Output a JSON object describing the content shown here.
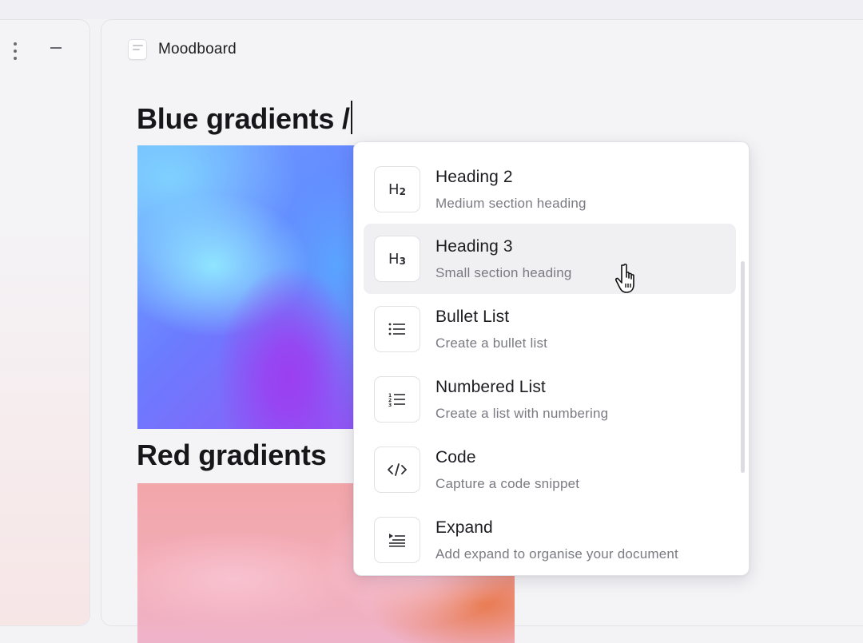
{
  "document": {
    "title": "Moodboard",
    "heading_blue": "Blue gradients /",
    "heading_red": "Red gradients"
  },
  "slash_menu": {
    "items": [
      {
        "title": "Heading 2",
        "description": "Medium section heading",
        "icon": "heading-2-icon",
        "glyph": "H",
        "sub": "2",
        "active": false
      },
      {
        "title": "Heading 3",
        "description": "Small section heading",
        "icon": "heading-3-icon",
        "glyph": "H",
        "sub": "3",
        "active": true
      },
      {
        "title": "Bullet List",
        "description": "Create a bullet list",
        "icon": "bullet-list-icon",
        "active": false
      },
      {
        "title": "Numbered List",
        "description": "Create a list with numbering",
        "icon": "numbered-list-icon",
        "active": false
      },
      {
        "title": "Code",
        "description": "Capture a code snippet",
        "icon": "code-icon",
        "active": false
      },
      {
        "title": "Expand",
        "description": "Add expand to organise your document",
        "icon": "expand-icon",
        "active": false
      }
    ]
  },
  "colors": {
    "background": "#f3f3f6",
    "panel": "#f4f4f7",
    "menu_bg": "#ffffff",
    "active_item": "#f0f0f3",
    "text_primary": "#1d1d22",
    "text_secondary": "#7a7a82"
  }
}
